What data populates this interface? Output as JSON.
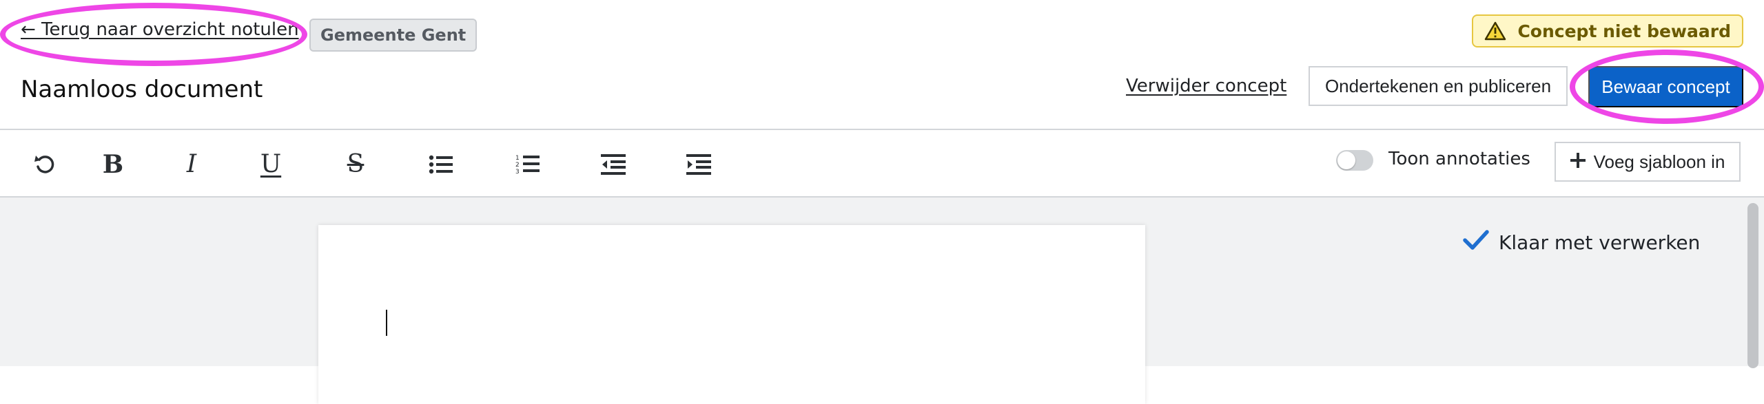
{
  "header": {
    "back_link": "← Terug naar overzicht notulen",
    "organisation": "Gemeente Gent",
    "document_title": "Naamloos document",
    "status_badge": "Concept niet bewaard",
    "delete_link": "Verwijder concept",
    "sign_publish_button": "Ondertekenen en publiceren",
    "save_button": "Bewaar concept"
  },
  "toolbar": {
    "buttons": [
      {
        "name": "undo",
        "icon": "undo-icon"
      },
      {
        "name": "bold",
        "icon": "bold-icon",
        "glyph": "B"
      },
      {
        "name": "italic",
        "icon": "italic-icon",
        "glyph": "I"
      },
      {
        "name": "underline",
        "icon": "underline-icon",
        "glyph": "U"
      },
      {
        "name": "strikethrough",
        "icon": "strikethrough-icon",
        "glyph": "S"
      },
      {
        "name": "unordered-list",
        "icon": "bulleted-list-icon"
      },
      {
        "name": "ordered-list",
        "icon": "numbered-list-icon"
      },
      {
        "name": "outdent",
        "icon": "outdent-icon"
      },
      {
        "name": "indent",
        "icon": "indent-icon"
      }
    ],
    "annotations_toggle_label": "Toon annotaties",
    "annotations_toggle_on": false,
    "insert_template_button": "Voeg sjabloon in"
  },
  "sidebar": {
    "status": "Klaar met verwerken"
  },
  "colors": {
    "primary": "#0b62c8",
    "highlight": "#ee46e6",
    "warning_bg": "#fff7c7",
    "success_check": "#1f6fd0"
  }
}
